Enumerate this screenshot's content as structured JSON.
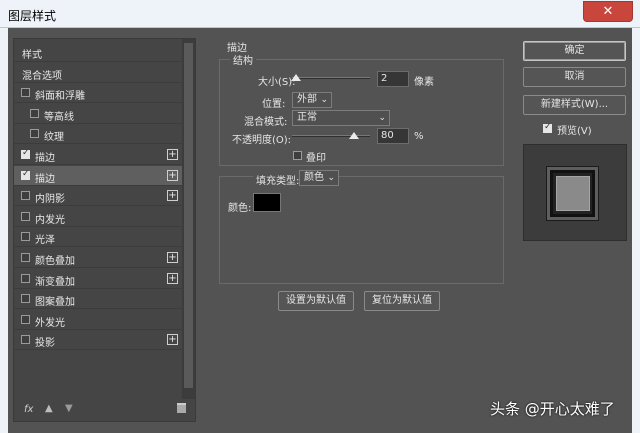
{
  "window": {
    "title": "图层样式",
    "close_icon": "close-icon"
  },
  "sidebar": {
    "items": [
      {
        "label": "样式",
        "type": "header"
      },
      {
        "label": "混合选项",
        "type": "header"
      },
      {
        "label": "斜面和浮雕",
        "checked": false,
        "plus": false,
        "indent": false
      },
      {
        "label": "等高线",
        "checked": false,
        "plus": false,
        "indent": true
      },
      {
        "label": "纹理",
        "checked": false,
        "plus": false,
        "indent": true
      },
      {
        "label": "描边",
        "checked": true,
        "plus": true,
        "indent": false
      },
      {
        "label": "描边",
        "checked": true,
        "plus": true,
        "indent": false,
        "selected": true
      },
      {
        "label": "内阴影",
        "checked": false,
        "plus": true,
        "indent": false
      },
      {
        "label": "内发光",
        "checked": false,
        "plus": false,
        "indent": false
      },
      {
        "label": "光泽",
        "checked": false,
        "plus": false,
        "indent": false
      },
      {
        "label": "颜色叠加",
        "checked": false,
        "plus": true,
        "indent": false
      },
      {
        "label": "渐变叠加",
        "checked": false,
        "plus": true,
        "indent": false
      },
      {
        "label": "图案叠加",
        "checked": false,
        "plus": false,
        "indent": false
      },
      {
        "label": "外发光",
        "checked": false,
        "plus": false,
        "indent": false
      },
      {
        "label": "投影",
        "checked": false,
        "plus": true,
        "indent": false
      }
    ],
    "footer": {
      "fx_label": "fx"
    }
  },
  "stroke": {
    "section_title": "描边",
    "structure_title": "结构",
    "size_label": "大小(S):",
    "size_value": "2",
    "size_unit": "像素",
    "position_label": "位置:",
    "position_value": "外部",
    "blend_label": "混合模式:",
    "blend_value": "正常",
    "opacity_label": "不透明度(O):",
    "opacity_value": "80",
    "opacity_unit": "%",
    "emboss_label": "叠印",
    "fill_type_label": "填充类型:",
    "fill_type_value": "颜色",
    "color_label": "颜色:",
    "color_value": "#000000",
    "set_default_button": "设置为默认值",
    "reset_default_button": "复位为默认值"
  },
  "actions": {
    "ok_button": "确定",
    "cancel_button": "取消",
    "new_style_button": "新建样式(W)...",
    "preview_label": "预览(V)",
    "preview_checked": true
  },
  "watermark": "头条 @开心太难了"
}
